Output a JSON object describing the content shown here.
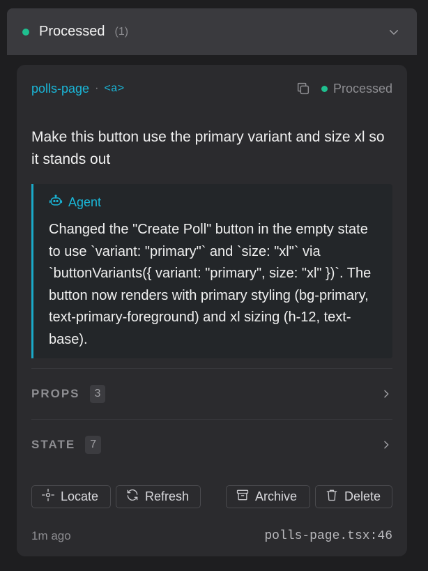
{
  "section": {
    "title": "Processed",
    "count": "(1)",
    "status_color": "#1fbf8f",
    "chevron_icon": "chevron-down-icon"
  },
  "card": {
    "component_name": "polls-page",
    "separator": "·",
    "element_tag": "<a>",
    "copy_icon": "copy-icon",
    "status": "Processed",
    "message": "Make this button use the primary variant and size xl so it stands out",
    "agent": {
      "icon": "bot-icon",
      "label": "Agent",
      "response": "Changed the \"Create Poll\" button in the empty state to use `variant: \"primary\"` and `size: \"xl\"` via `buttonVariants({ variant: \"primary\", size: \"xl\" })`. The button now renders with primary styling (bg-primary, text-primary-foreground) and xl sizing (h-12, text-base)."
    },
    "props": {
      "label": "PROPS",
      "count": "3"
    },
    "state": {
      "label": "STATE",
      "count": "7"
    },
    "actions": {
      "locate": "Locate",
      "refresh": "Refresh",
      "archive": "Archive",
      "delete": "Delete"
    },
    "footer": {
      "time": "1m ago",
      "file": "polls-page.tsx:46"
    }
  },
  "colors": {
    "accent": "#1ab7d8",
    "success": "#1fbf8f",
    "background": "#1e1e20",
    "card": "#2b2b2e"
  }
}
